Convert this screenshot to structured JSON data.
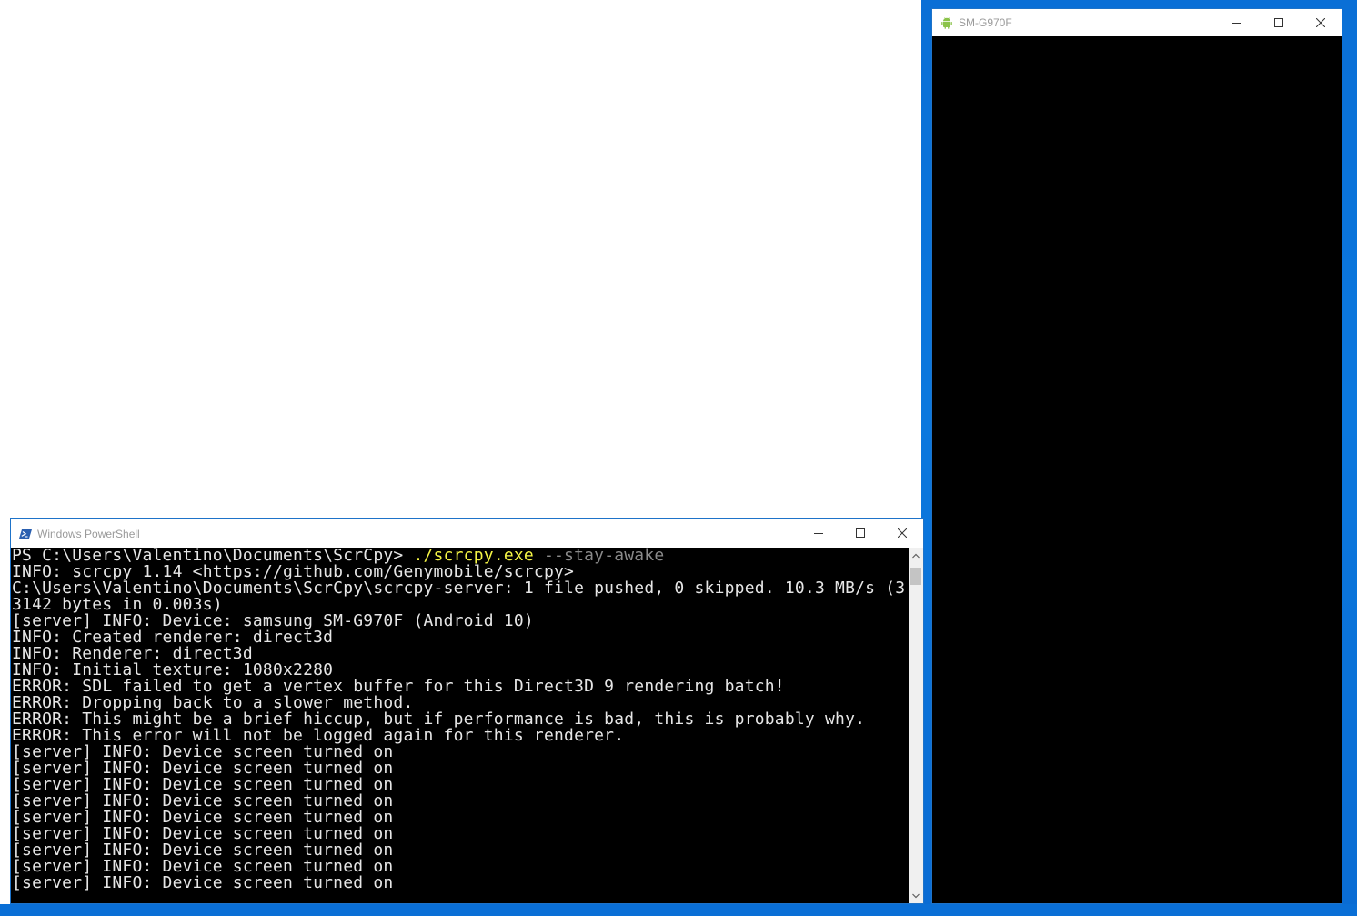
{
  "scrcpy_window": {
    "title": "SM-G970F"
  },
  "powershell_window": {
    "title": "Windows PowerShell",
    "prompt": "PS C:\\Users\\Valentino\\Documents\\ScrCpy> ",
    "command": "./scrcpy.exe",
    "argument": " --stay-awake",
    "lines": [
      "INFO: scrcpy 1.14 <https://github.com/Genymobile/scrcpy>",
      "C:\\Users\\Valentino\\Documents\\ScrCpy\\scrcpy-server: 1 file pushed, 0 skipped. 10.3 MB/s (3",
      "3142 bytes in 0.003s)",
      "[server] INFO: Device: samsung SM-G970F (Android 10)",
      "INFO: Created renderer: direct3d",
      "INFO: Renderer: direct3d",
      "INFO: Initial texture: 1080x2280",
      "ERROR: SDL failed to get a vertex buffer for this Direct3D 9 rendering batch!",
      "ERROR: Dropping back to a slower method.",
      "ERROR: This might be a brief hiccup, but if performance is bad, this is probably why.",
      "ERROR: This error will not be logged again for this renderer.",
      "[server] INFO: Device screen turned on",
      "[server] INFO: Device screen turned on",
      "[server] INFO: Device screen turned on",
      "[server] INFO: Device screen turned on",
      "[server] INFO: Device screen turned on",
      "[server] INFO: Device screen turned on",
      "[server] INFO: Device screen turned on",
      "[server] INFO: Device screen turned on",
      "[server] INFO: Device screen turned on"
    ]
  },
  "icons": {
    "scrcpy_app": "android-icon",
    "powershell_app": "powershell-icon",
    "minimize": "minimize-icon",
    "maximize": "maximize-icon",
    "close": "close-icon",
    "scroll_up": "chevron-up-icon",
    "scroll_down": "chevron-down-icon"
  },
  "colors": {
    "desktop": "#0a6fd6",
    "console_bg": "#000000",
    "console_text": "#e6e6e6",
    "command_highlight": "#f5f545",
    "argument_text": "#8a8a8a",
    "android_green": "#8bc34a"
  }
}
